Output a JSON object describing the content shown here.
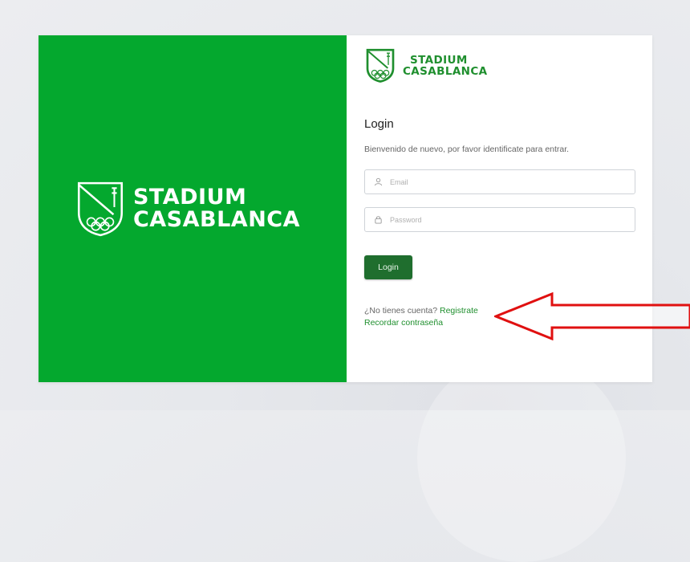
{
  "brand": {
    "line1": "STADIUM",
    "line2": "CASABLANCA",
    "color_green": "#04a82e",
    "color_dark_green": "#1f6e2e"
  },
  "login": {
    "title": "Login",
    "subtitle": "Bienvenido de nuevo, por favor identificate para entrar.",
    "email_placeholder": "Email",
    "password_placeholder": "Password",
    "button_label": "Login"
  },
  "links": {
    "no_account_text": "¿No tienes cuenta?",
    "register_label": "Registrate",
    "remember_password_label": "Recordar contraseña"
  },
  "annotation": {
    "arrow_color": "#e01010",
    "arrow_direction": "left"
  },
  "icons": {
    "email": "user-icon",
    "password": "lock-icon",
    "logo": "shield-logo-icon"
  }
}
